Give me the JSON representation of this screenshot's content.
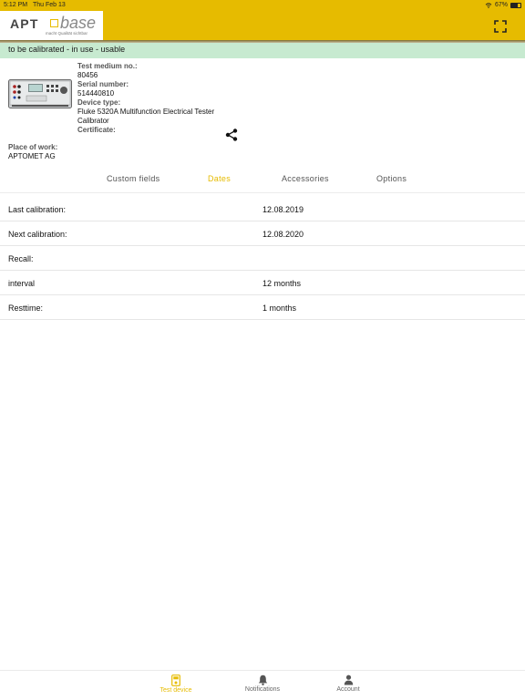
{
  "statusbar": {
    "time": "5:12 PM",
    "date": "Thu Feb 13",
    "battery": "67%",
    "battery_level": 0.67
  },
  "header": {
    "logo_apt": "APT",
    "logo_base": "base",
    "logo_tagline": "macht Qualität sichtbar",
    "accent_color": "#e6bb00"
  },
  "status_banner": "to be calibrated - in use - usable",
  "device": {
    "test_medium_label": "Test medium no.:",
    "test_medium_value": "80456",
    "serial_label": "Serial number:",
    "serial_value": "514440810",
    "device_type_label": "Device type:",
    "device_type_value_line1": "Fluke 5320A Multifunction Electrical Tester",
    "device_type_value_line2": "Calibrator",
    "certificate_label": "Certificate:",
    "place_label": "Place of work:",
    "place_value": "APTOMET AG"
  },
  "tabs": [
    "Custom fields",
    "Dates",
    "Accessories",
    "Options"
  ],
  "active_tab": "Dates",
  "dates": [
    {
      "label": "Last calibration:",
      "value": "12.08.2019"
    },
    {
      "label": "Next calibration:",
      "value": "12.08.2020"
    },
    {
      "label": "Recall:",
      "value": ""
    },
    {
      "label": "interval",
      "value": "12 months"
    },
    {
      "label": "Resttime:",
      "value": "1 months"
    }
  ],
  "bottom_nav": [
    {
      "label": "Test device",
      "icon": "test-device-icon",
      "active": true
    },
    {
      "label": "Notifications",
      "icon": "bell-icon",
      "active": false
    },
    {
      "label": "Account",
      "icon": "person-icon",
      "active": false
    }
  ]
}
